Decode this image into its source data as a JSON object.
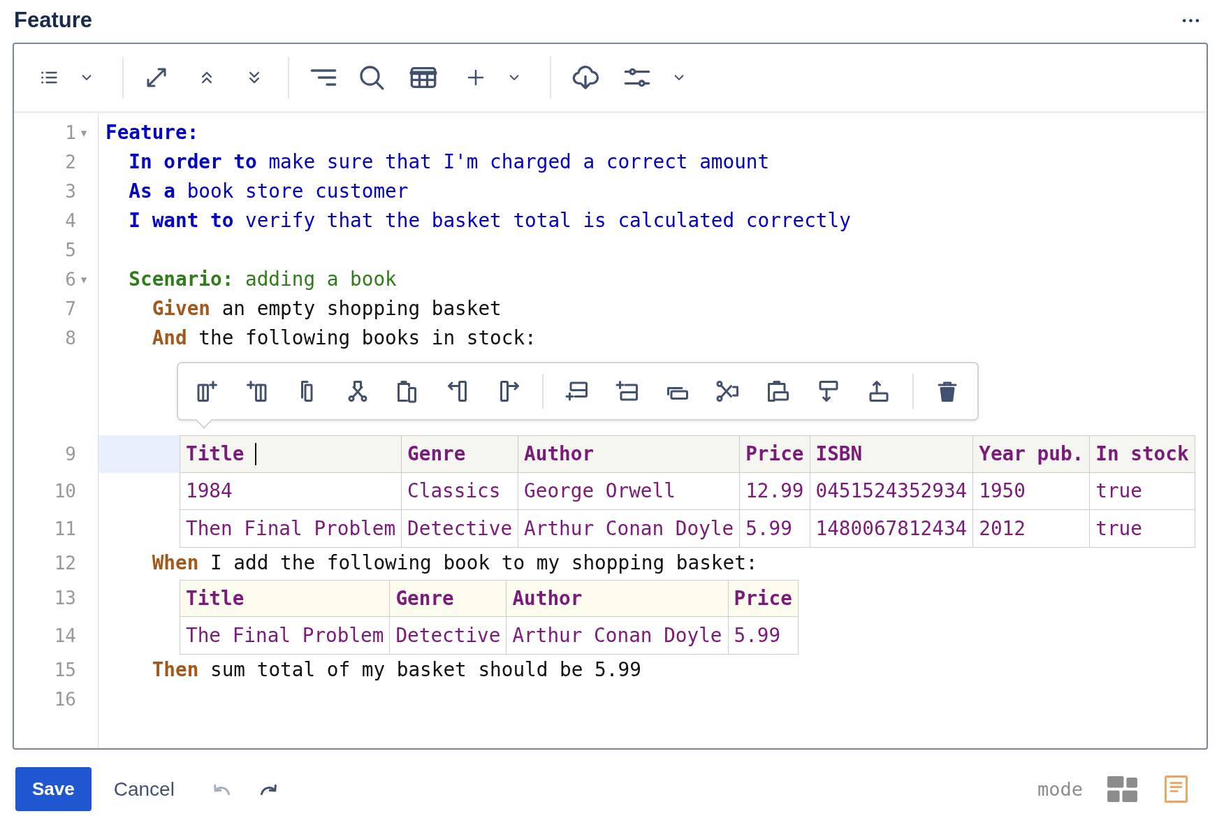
{
  "page": {
    "title": "Feature"
  },
  "editor": {
    "lines": [
      {
        "kind": "line",
        "number": "1",
        "fold_marker": "▾",
        "tokens": [
          {
            "kind": "feature_keyword",
            "text": "Feature:"
          }
        ],
        "children": [
          {
            "kind": "line",
            "number": "2",
            "tokens": [
              {
                "kind": "feature_keyword",
                "text": "In order to"
              },
              {
                "kind": "description",
                "text": "make sure that I'm charged a correct amount"
              }
            ]
          },
          {
            "kind": "line",
            "number": "3",
            "tokens": [
              {
                "kind": "feature_keyword",
                "text": "As a"
              },
              {
                "kind": "description",
                "text": "book store customer"
              }
            ]
          },
          {
            "kind": "line",
            "number": "4",
            "tokens": [
              {
                "kind": "feature_keyword",
                "text": "I want to"
              },
              {
                "kind": "description",
                "text": "verify that the basket total is calculated correctly"
              }
            ]
          },
          {
            "kind": "line",
            "number": "5"
          },
          {
            "kind": "line",
            "number": "6",
            "fold_marker": "▾",
            "tokens": [
              {
                "kind": "scenario_keyword",
                "text": "Scenario:"
              },
              {
                "kind": "scenario_name",
                "text": "adding a book"
              }
            ],
            "children": [
              {
                "kind": "line",
                "number": "7",
                "tokens": [
                  {
                    "kind": "step_keyword",
                    "text": "Given"
                  },
                  {
                    "kind": "step_text",
                    "text": "an empty shopping basket"
                  }
                ]
              },
              {
                "kind": "line",
                "number": "8",
                "tokens": [
                  {
                    "kind": "step_keyword",
                    "text": "And"
                  },
                  {
                    "kind": "step_text",
                    "text": "the following books in stock:"
                  }
                ],
                "children": [
                  {
                    "kind": "table",
                    "selected": true,
                    "header": {
                      "number": "9",
                      "cells": [
                        {
                          "text": "Title",
                          "caret": true
                        },
                        {
                          "text": "Genre",
                          "caret": false
                        },
                        {
                          "text": "Author",
                          "caret": false
                        },
                        {
                          "text": "Price",
                          "caret": false
                        },
                        {
                          "text": "ISBN",
                          "caret": false
                        },
                        {
                          "text": "Year pub.",
                          "caret": false
                        },
                        {
                          "text": "In stock",
                          "caret": false
                        }
                      ]
                    },
                    "rows": [
                      {
                        "number": "10",
                        "cells": [
                          "1984",
                          "Classics",
                          "George Orwell",
                          "12.99",
                          "0451524352934",
                          "1950",
                          "true"
                        ]
                      },
                      {
                        "number": "11",
                        "cells": [
                          "Then Final Problem",
                          "Detective",
                          "Arthur Conan Doyle",
                          "5.99",
                          "1480067812434",
                          "2012",
                          "true"
                        ]
                      }
                    ]
                  }
                ]
              },
              {
                "kind": "line",
                "number": "12",
                "tokens": [
                  {
                    "kind": "step_keyword",
                    "text": "When"
                  },
                  {
                    "kind": "step_text",
                    "text": "I add the following book to my shopping basket:"
                  }
                ],
                "children": [
                  {
                    "kind": "table",
                    "selected": false,
                    "header": {
                      "number": "13",
                      "cells": [
                        {
                          "text": "Title",
                          "caret": false
                        },
                        {
                          "text": "Genre",
                          "caret": false
                        },
                        {
                          "text": "Author",
                          "caret": false
                        },
                        {
                          "text": "Price",
                          "caret": false
                        }
                      ]
                    },
                    "rows": [
                      {
                        "number": "14",
                        "cells": [
                          "The Final Problem",
                          "Detective",
                          "Arthur Conan Doyle",
                          "5.99"
                        ]
                      }
                    ]
                  }
                ]
              },
              {
                "kind": "line",
                "number": "15",
                "tokens": [
                  {
                    "kind": "step_keyword",
                    "text": "Then"
                  },
                  {
                    "kind": "step_text",
                    "text": "sum total of my basket should be 5.99"
                  }
                ]
              },
              {
                "kind": "line",
                "number": "16"
              }
            ]
          }
        ]
      }
    ]
  },
  "footer": {
    "save": "Save",
    "cancel": "Cancel",
    "undo": {
      "disabled": true
    },
    "redo": {
      "disabled": false
    },
    "mode_label": "mode",
    "modes": [
      {
        "kind": "grid",
        "selected": false
      },
      {
        "kind": "document",
        "selected": true
      }
    ]
  }
}
